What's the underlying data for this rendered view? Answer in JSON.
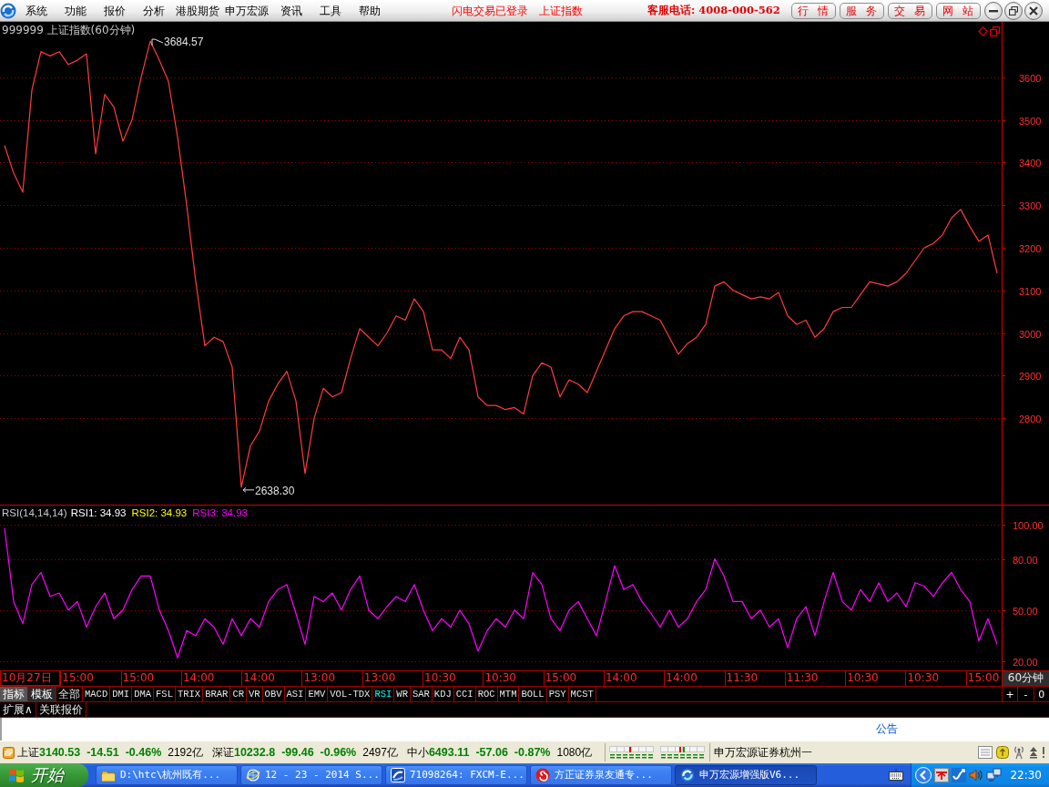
{
  "menu_bar": {
    "menu": [
      "系统",
      "功能",
      "报价",
      "分析",
      "港股期货",
      "申万宏源",
      "资讯",
      "工具",
      "帮助"
    ],
    "status_links": [
      "闪电交易已登录",
      "上证指数"
    ],
    "hotline": "客服电话: 4008-000-562",
    "buttons": [
      "行 情",
      "服 务",
      "交 易",
      "网 站"
    ]
  },
  "price_chart": {
    "title": "999999 上证指数(60分钟)",
    "chart_data": {
      "type": "line",
      "grid": true,
      "ylim": [
        2595,
        3730
      ],
      "yticks": [
        2800,
        2900,
        3000,
        3100,
        3200,
        3300,
        3400,
        3500,
        3600
      ],
      "series": [
        {
          "color": "#ff3c3c",
          "values": [
            3440,
            3375,
            3330,
            3570,
            3660,
            3650,
            3660,
            3630,
            3640,
            3655,
            3420,
            3560,
            3530,
            3450,
            3500,
            3600,
            3685,
            3640,
            3590,
            3460,
            3300,
            3120,
            2970,
            2990,
            2980,
            2920,
            2638,
            2735,
            2770,
            2840,
            2880,
            2910,
            2840,
            2670,
            2800,
            2870,
            2850,
            2860,
            2940,
            3010,
            2990,
            2970,
            3000,
            3040,
            3030,
            3080,
            3050,
            2960,
            2960,
            2940,
            2990,
            2960,
            2850,
            2830,
            2830,
            2820,
            2825,
            2810,
            2900,
            2930,
            2920,
            2850,
            2890,
            2880,
            2860,
            2910,
            2960,
            3010,
            3040,
            3050,
            3050,
            3040,
            3030,
            2990,
            2950,
            2975,
            2990,
            3020,
            3110,
            3120,
            3100,
            3090,
            3080,
            3085,
            3080,
            3095,
            3040,
            3020,
            3030,
            2990,
            3010,
            3050,
            3060,
            3060,
            3090,
            3120,
            3115,
            3110,
            3120,
            3140,
            3170,
            3200,
            3210,
            3230,
            3270,
            3290,
            3250,
            3215,
            3230,
            3140
          ]
        }
      ],
      "annotations": [
        "3684.57",
        "2638.30"
      ]
    }
  },
  "rsi_chart": {
    "title": "RSI(14,14,14)",
    "legend": [
      {
        "label": "RSI1: 34.93",
        "color": "#ffffff"
      },
      {
        "label": "RSI2: 34.93",
        "color": "#ffff00"
      },
      {
        "label": "RSI3: 34.93",
        "color": "#ff00ff"
      }
    ],
    "chart_data": {
      "type": "line",
      "grid": true,
      "ylim": [
        14.7,
        111.2
      ],
      "yticks": [
        {
          "value": 100,
          "label": "100.00"
        },
        {
          "value": 80,
          "label": "80.00"
        },
        {
          "value": 50,
          "label": "50.00"
        },
        {
          "value": 20,
          "label": "20.00"
        }
      ],
      "series": [
        {
          "color": "#ff00ff",
          "values": [
            98,
            55,
            42,
            65,
            72,
            58,
            60,
            50,
            55,
            40,
            52,
            60,
            45,
            50,
            62,
            70,
            70,
            50,
            38,
            22,
            38,
            35,
            45,
            40,
            30,
            45,
            35,
            45,
            40,
            55,
            62,
            65,
            48,
            30,
            58,
            55,
            60,
            50,
            62,
            70,
            50,
            45,
            52,
            58,
            55,
            65,
            50,
            38,
            45,
            40,
            50,
            42,
            26,
            38,
            45,
            40,
            50,
            45,
            72,
            65,
            45,
            38,
            50,
            55,
            45,
            35,
            55,
            76,
            62,
            65,
            55,
            48,
            40,
            50,
            40,
            45,
            55,
            62,
            80,
            70,
            55,
            55,
            45,
            50,
            40,
            45,
            28,
            45,
            52,
            35,
            55,
            72,
            55,
            50,
            62,
            55,
            66,
            55,
            60,
            52,
            66,
            64,
            58,
            66,
            72,
            62,
            55,
            32,
            45,
            30
          ]
        }
      ]
    }
  },
  "time_axis": {
    "labels": [
      "10月27日",
      "15:00",
      "15:00",
      "14:00",
      "14:00",
      "13:00",
      "13:00",
      "10:30",
      "10:30",
      "15:00",
      "14:00",
      "14:00",
      "11:30",
      "11:30",
      "10:30",
      "10:30",
      "15:00"
    ],
    "period": "60分钟"
  },
  "indicator_bar": {
    "panel_tabs": [
      {
        "label": "指标",
        "selected": true
      },
      {
        "label": "模板",
        "selected": false
      }
    ],
    "indicators": [
      {
        "label": "全部",
        "selected": false
      },
      {
        "label": "MACD",
        "selected": false
      },
      {
        "label": "DMI",
        "selected": false
      },
      {
        "label": "DMA",
        "selected": false
      },
      {
        "label": "FSL",
        "selected": false
      },
      {
        "label": "TRIX",
        "selected": false
      },
      {
        "label": "BRAR",
        "selected": false
      },
      {
        "label": "CR",
        "selected": false
      },
      {
        "label": "VR",
        "selected": false
      },
      {
        "label": "OBV",
        "selected": false
      },
      {
        "label": "ASI",
        "selected": false
      },
      {
        "label": "EMV",
        "selected": false
      },
      {
        "label": "VOL-TDX",
        "selected": false
      },
      {
        "label": "RSI",
        "selected": true
      },
      {
        "label": "WR",
        "selected": false
      },
      {
        "label": "SAR",
        "selected": false
      },
      {
        "label": "KDJ",
        "selected": false
      },
      {
        "label": "CCI",
        "selected": false
      },
      {
        "label": "ROC",
        "selected": false
      },
      {
        "label": "MTM",
        "selected": false
      },
      {
        "label": "BOLL",
        "selected": false
      },
      {
        "label": "PSY",
        "selected": false
      },
      {
        "label": "MCST",
        "selected": false
      }
    ],
    "zoom_buttons": [
      "+",
      "-",
      "0"
    ]
  },
  "extra_tabs": [
    "扩展∧",
    "关联报价"
  ],
  "notice": "公告",
  "status_bar": {
    "indices": [
      {
        "name": "上证",
        "price": "3140.53",
        "change": "-14.51",
        "percent": "-0.46%",
        "turnover": "2192亿"
      },
      {
        "name": "深证",
        "price": "10232.8",
        "change": "-99.46",
        "percent": "-0.96%",
        "turnover": "2497亿"
      },
      {
        "name": "中小",
        "price": "6493.11",
        "change": "-57.06",
        "percent": "-0.87%",
        "turnover": "1080亿"
      }
    ],
    "broker": "申万宏源证券杭州一"
  },
  "taskbar": {
    "start": "开始",
    "tasks": [
      {
        "label": "D:\\htc\\杭州既有...",
        "selected": false
      },
      {
        "label": "12 - 23 - 2014 S...",
        "selected": false
      },
      {
        "label": "71098264: FXCM-E...",
        "selected": false
      },
      {
        "label": "方正证券泉友通专...",
        "selected": false
      },
      {
        "label": "申万宏源增强版V6...",
        "selected": true
      }
    ],
    "clock": "22:30"
  }
}
